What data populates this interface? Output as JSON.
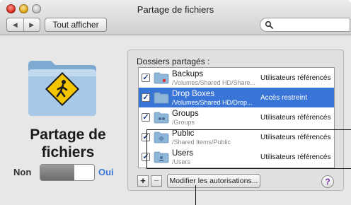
{
  "window": {
    "title": "Partage  de fichiers",
    "nav_back": "◀",
    "nav_forward": "▶",
    "show_all": "Tout afficher"
  },
  "left_pane": {
    "title_line1": "Partage de",
    "title_line2": "fichiers",
    "toggle_off": "Non",
    "toggle_on": "Oui"
  },
  "shared": {
    "label": "Dossiers partagés :",
    "rows": [
      {
        "name": "Backups",
        "path": "/Volumes/Shared HD/Share...",
        "access": "Utilisateurs référencés",
        "checked": true,
        "selected": false
      },
      {
        "name": "Drop Boxes",
        "path": "/Volumes/Shared HD/Drop...",
        "access": "Accès restreint",
        "checked": true,
        "selected": true
      },
      {
        "name": "Groups",
        "path": "/Groups",
        "access": "Utilisateurs référencés",
        "checked": true,
        "selected": false
      },
      {
        "name": "Public",
        "path": "/Shared Items/Public",
        "access": "Utilisateurs référencés",
        "checked": true,
        "selected": false
      },
      {
        "name": "Users",
        "path": "/Users",
        "access": "Utilisateurs référencés",
        "checked": true,
        "selected": false
      }
    ],
    "add_label": "+",
    "remove_label": "−",
    "permissions_button": "Modifier les autorisations...",
    "help_label": "?"
  },
  "colors": {
    "selection": "#3875d7",
    "oui": "#3a78d8",
    "folder": "#8eb6d9"
  },
  "icons": {
    "search": "search-icon",
    "folder": "folder-icon",
    "pedestrian_sign": "pedestrian-sign-icon"
  }
}
